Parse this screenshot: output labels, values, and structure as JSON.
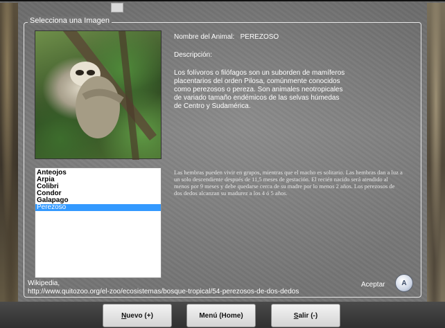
{
  "group_title": "Selecciona una Imagen",
  "animal": {
    "name_label": "Nombre del Animal:",
    "name_value": "PEREZOSO",
    "description_label": "Descripción:",
    "description_text": "Los folívoros o filófagos son un suborden de mamíferos placentarios del orden Pilosa, comúnmente conocidos como perezosos o pereza. Son animales neotropicales de variado tamaño endémicos de las selvas húmedas de Centro y Sudamérica.",
    "extra_text": "Las hembras pueden vivir en grupos, mientras que el macho es solitario. Las hembras dan a luz a un solo descendiente después de 11,5 meses de gestación. El recién nacido será atendido al menos por 9 meses y debe quedarse cerca de su madre por lo menos 2 años. Los perezosos de dos dedos alcanzan su madurez a los 4 ó 5 años."
  },
  "list": {
    "items": [
      "Anteojos",
      "Arpia",
      "Colibri",
      "Condor",
      "Galapago",
      "Perezoso"
    ],
    "selected_index": 5
  },
  "source": {
    "line1": "Wikipedia,",
    "line2": "http://www.quitozoo.org/el-zoo/ecosistemas/bosque-tropical/54-perezosos-de-dos-dedos"
  },
  "accept": {
    "label": "Aceptar",
    "icon_glyph": "A",
    "icon": "accept-circle-icon"
  },
  "buttons": {
    "new_first": "N",
    "new_rest": "uevo (+)",
    "menu": "Menú (Home)",
    "exit_first": "S",
    "exit_rest": "alir (-)"
  },
  "colors": {
    "selection": "#3399ff",
    "background": "#757575"
  }
}
